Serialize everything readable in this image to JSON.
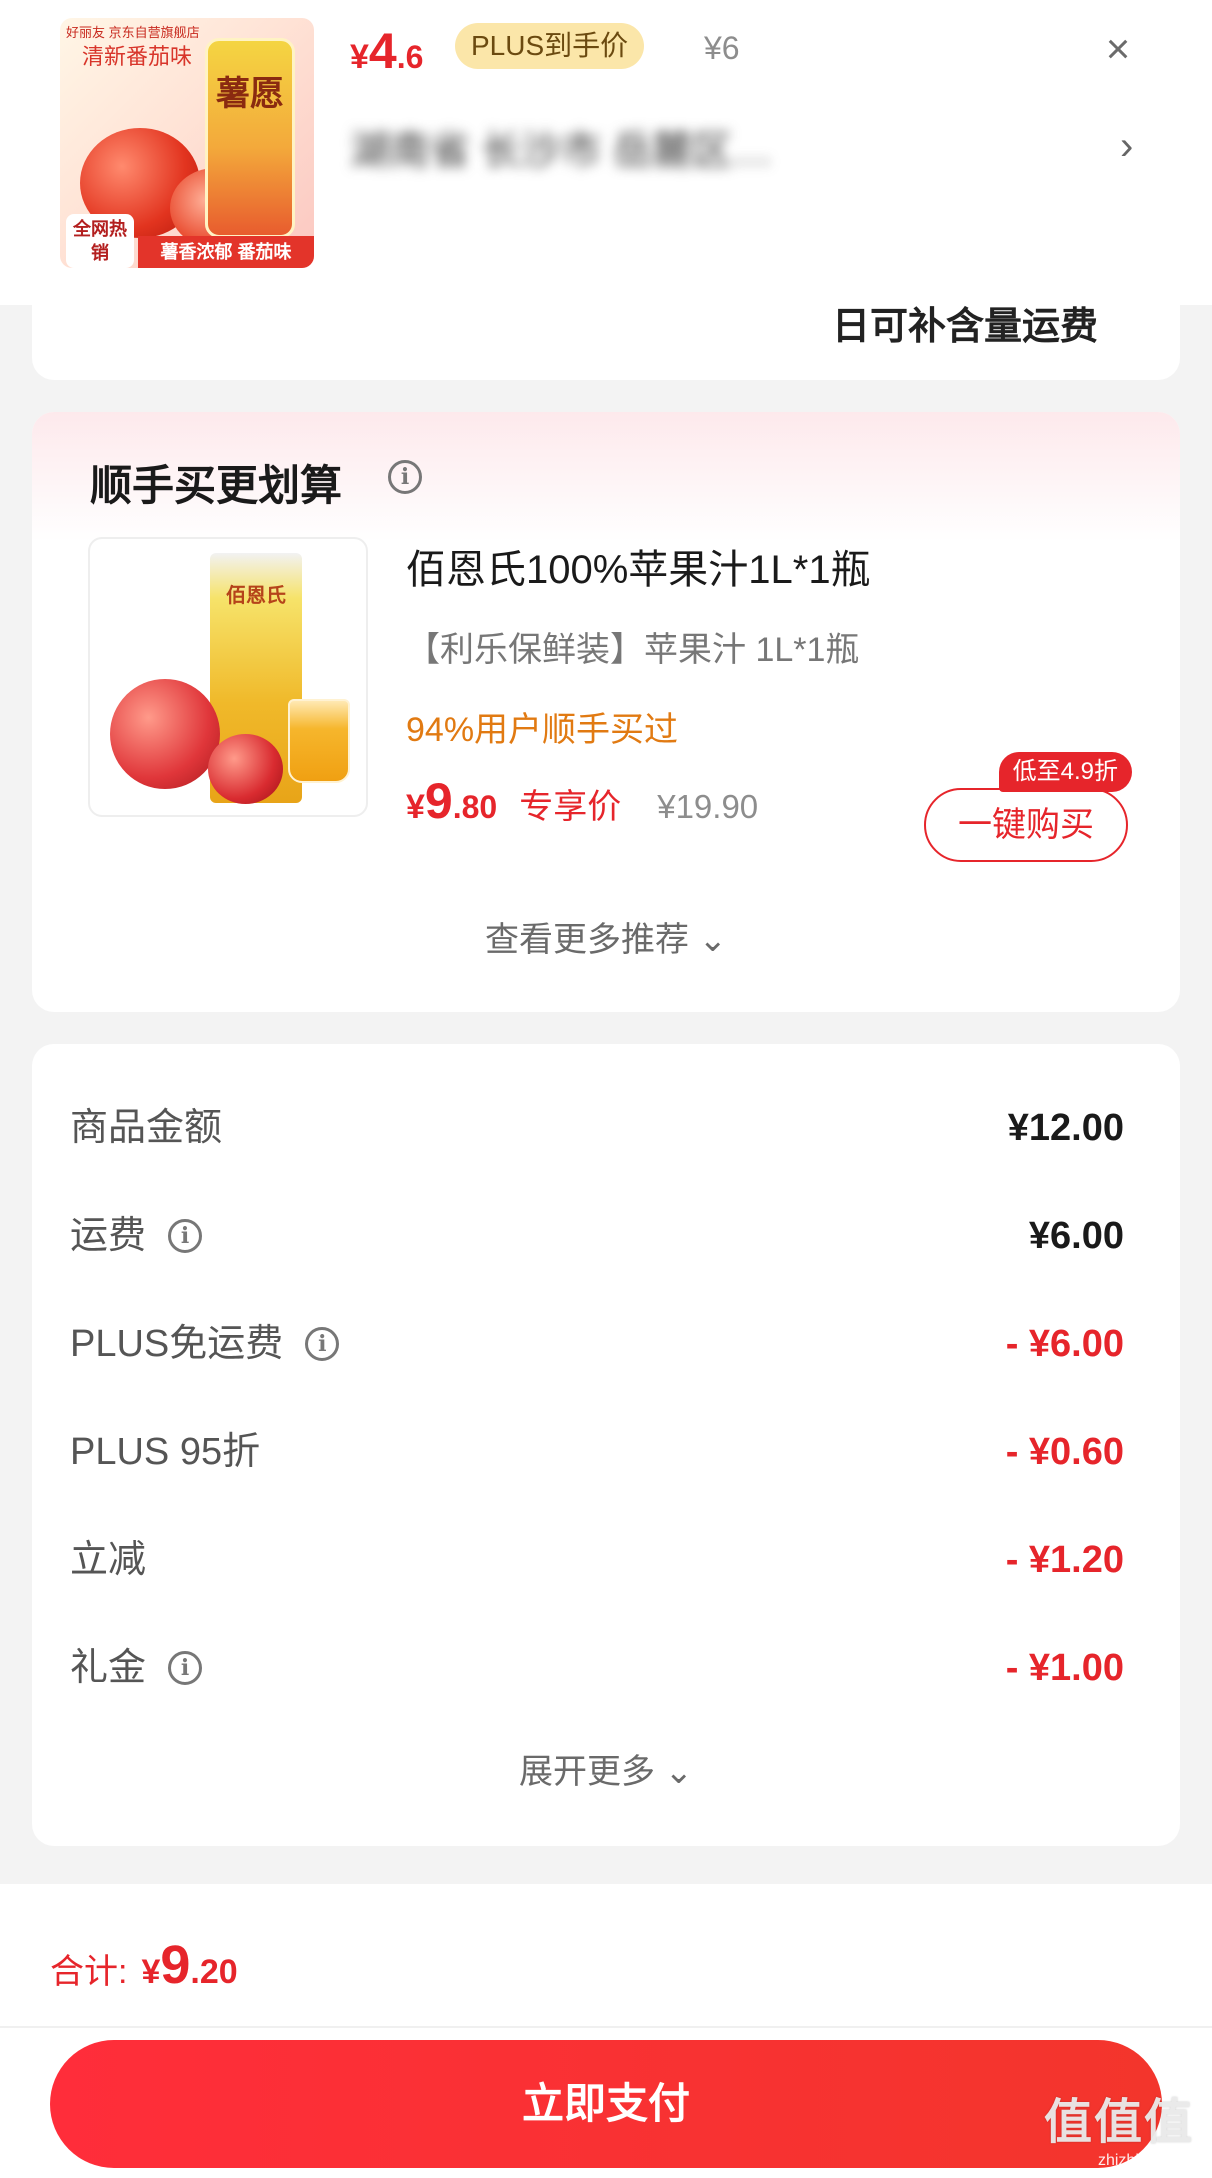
{
  "top": {
    "thumb": {
      "brand": "好丽友 京东自营旗舰店",
      "hand": "清新番茄味",
      "can_label": "薯愿",
      "hot": "全网热销",
      "strip": "薯香浓郁 番茄味"
    },
    "price_symbol": "¥",
    "price_int": "4",
    "price_dec": ".6",
    "plus_tag": "PLUS到手价",
    "orig_price": "¥6",
    "address_blurred": "湖南省 长沙市 岳麓区…",
    "close_icon": "×",
    "chevron_icon": "›"
  },
  "card1": {
    "partial_text": "日可补含量运费"
  },
  "recommend": {
    "title": "顺手买更划算",
    "product": {
      "name": "佰恩氏100%苹果汁1L*1瓶",
      "sub": "【利乐保鲜装】苹果汁 1L*1瓶",
      "rate": "94%用户顺手买过",
      "price_symbol": "¥",
      "price_int": "9",
      "price_dec": ".80",
      "exclusive": "专享价",
      "orig_price": "¥19.90",
      "img_label": "佰恩氏"
    },
    "buy_badge": "低至4.9折",
    "buy_button": "一键购买",
    "more": "查看更多推荐 ⌄"
  },
  "summary": {
    "rows": [
      {
        "label": "商品金额",
        "value": "¥12.00",
        "info": false,
        "red": false
      },
      {
        "label": "运费",
        "value": "¥6.00",
        "info": true,
        "red": false
      },
      {
        "label": "PLUS免运费",
        "value": "- ¥6.00",
        "info": true,
        "red": true
      },
      {
        "label": "PLUS 95折",
        "value": "- ¥0.60",
        "info": false,
        "red": true
      },
      {
        "label": "立减",
        "value": "- ¥1.20",
        "info": false,
        "red": true
      },
      {
        "label": "礼金",
        "value": "- ¥1.00",
        "info": true,
        "red": true
      }
    ],
    "expand": "展开更多 ⌄"
  },
  "bottom": {
    "total_label": "合计:",
    "total_symbol": "¥",
    "total_int": "9",
    "total_dec": ".20",
    "pay_button": "立即支付"
  },
  "watermark": {
    "main": "值值值",
    "sub": "zhizhizhi.com"
  },
  "colors": {
    "accent": "#e6252b",
    "plus_tag_bg": "#fbe6a9",
    "rate": "#e17a12"
  }
}
